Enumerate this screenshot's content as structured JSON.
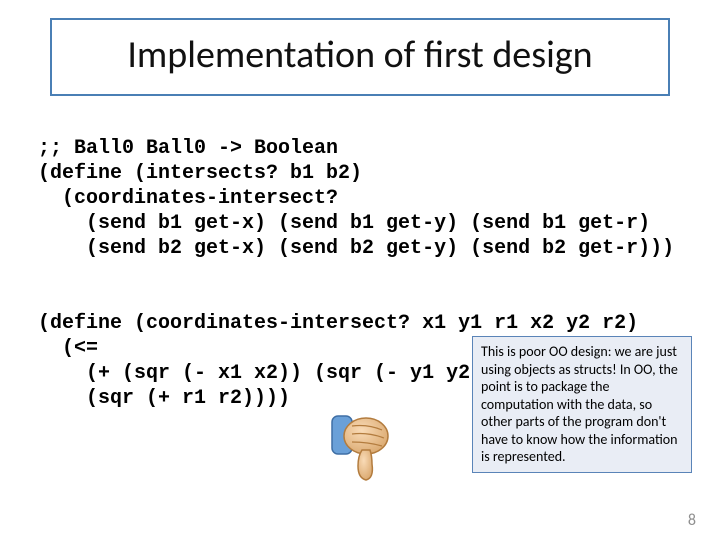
{
  "title": "Implementation of first design",
  "code": ";; Ball0 Ball0 -> Boolean\n(define (intersects? b1 b2)\n  (coordinates-intersect?\n    (send b1 get-x) (send b1 get-y) (send b1 get-r)\n    (send b2 get-x) (send b2 get-y) (send b2 get-r)))\n\n\n(define (coordinates-intersect? x1 y1 r1 x2 y2 r2)\n  (<=\n    (+ (sqr (- x1 x2)) (sqr (- y1 y2)))\n    (sqr (+ r1 r2))))",
  "callout": "This is poor OO design:  we are just using objects as structs!  In OO, the point is to package the computation with the data, so other parts of the program don't have to know how the information is represented.",
  "page_number": "8",
  "icons": {
    "thumbs_down": "thumbs-down-icon"
  }
}
